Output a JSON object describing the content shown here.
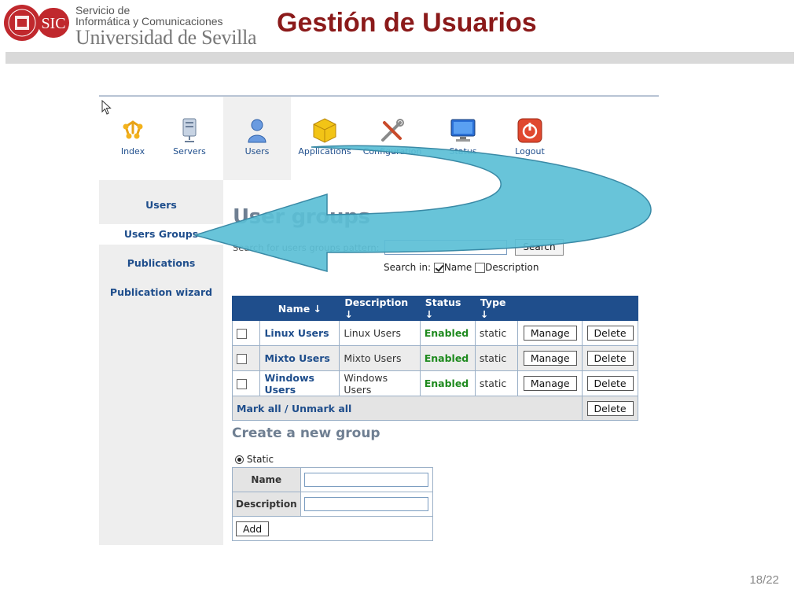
{
  "slide": {
    "org_line1": "Servicio de",
    "org_line2": "Informática y Comunicaciones",
    "org_line3": "Universidad de Sevilla",
    "logo_text": "SIC",
    "title": "Gestión de Usuarios",
    "page_number": "18/22"
  },
  "app": {
    "toolbar": [
      {
        "label": "Index",
        "icon": "index-icon"
      },
      {
        "label": "Servers",
        "icon": "server-icon"
      },
      {
        "label": "Users",
        "icon": "users-icon"
      },
      {
        "label": "Applications",
        "icon": "applications-icon"
      },
      {
        "label": "Configuration",
        "icon": "configuration-icon"
      },
      {
        "label": "Status",
        "icon": "monitor-icon"
      },
      {
        "label": "Logout",
        "icon": "power-icon"
      }
    ],
    "sidebar": [
      {
        "label": "Users"
      },
      {
        "label": "Users Groups"
      },
      {
        "label": "Publications"
      },
      {
        "label": "Publication wizard"
      }
    ],
    "page_title": "User groups",
    "search": {
      "label": "Search for users groups pattern:",
      "value": "",
      "button": "Search",
      "search_in_label": "Search in:",
      "option_name": "Name",
      "option_description": "Description"
    },
    "table": {
      "columns": [
        "Name ↓",
        "Description ↓",
        "Status ↓",
        "Type ↓"
      ],
      "rows": [
        {
          "name": "Linux Users",
          "description": "Linux Users",
          "status": "Enabled",
          "type": "static",
          "manage": "Manage",
          "delete": "Delete"
        },
        {
          "name": "Mixto Users",
          "description": "Mixto Users",
          "status": "Enabled",
          "type": "static",
          "manage": "Manage",
          "delete": "Delete"
        },
        {
          "name": "Windows Users",
          "description": "Windows Users",
          "status": "Enabled",
          "type": "static",
          "manage": "Manage",
          "delete": "Delete"
        }
      ],
      "footer_link": "Mark all / Unmark all",
      "footer_delete": "Delete"
    },
    "create": {
      "title": "Create a new group",
      "radio_label": "Static",
      "name_label": "Name",
      "description_label": "Description",
      "add_button": "Add"
    }
  },
  "colors": {
    "title_red": "#8b1a1a",
    "app_blue": "#1f4e8c",
    "arrow_cyan": "#5bbfd6",
    "enabled_green": "#1e8a1e"
  }
}
